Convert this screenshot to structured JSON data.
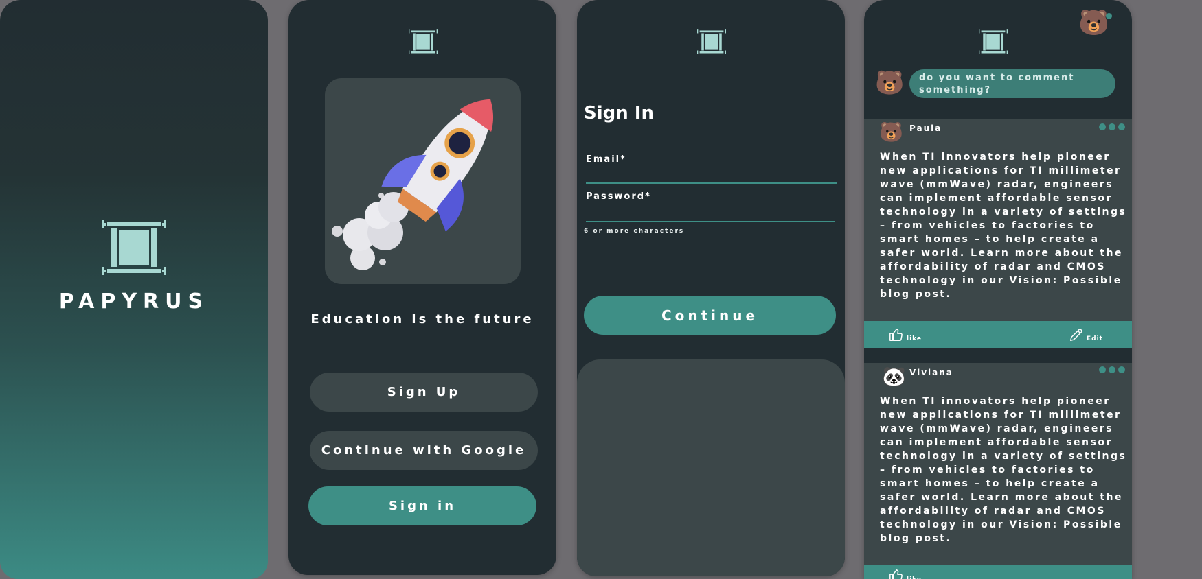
{
  "splash": {
    "brand": "PAPYRUS"
  },
  "welcome": {
    "tagline": "Education is the future",
    "signup_label": "Sign Up",
    "google_label": "Continue with Google",
    "signin_label": "Sign in"
  },
  "signin": {
    "title": "Sign In",
    "email_label": "Email*",
    "password_label": "Password*",
    "password_helper": "6 or more characters",
    "continue_label": "Continue"
  },
  "feed": {
    "comment_placeholder": "do you want to comment something?",
    "posts": [
      {
        "author": "Paula",
        "avatar": "🐻",
        "text": "When TI innovators help pioneer new applications for TI millimeter wave (mmWave) radar, engineers can implement affordable sensor technology in a variety of settings – from vehicles to factories to smart homes – to help create a safer world. Learn more about the affordability of radar and CMOS technology in our Vision: Possible blog post.",
        "like_label": "like",
        "edit_label": "Edit"
      },
      {
        "author": "Viviana",
        "avatar": "🐼",
        "text": "When TI innovators help pioneer new applications for TI millimeter wave (mmWave) radar, engineers can implement affordable sensor technology in a variety of settings – from vehicles to factories to smart homes – to help create a safer world. Learn more about the affordability of radar and CMOS technology in our Vision: Possible blog post.",
        "like_label": "like"
      }
    ],
    "user_avatar": "🐻"
  },
  "colors": {
    "background": "#222d32",
    "card": "#3c4749",
    "accent": "#3e8f86",
    "logo": "#a8d8d2",
    "page": "#6e6c70"
  },
  "icons": {
    "logo": "scroll-pillar-icon",
    "like": "thumbs-up-icon",
    "edit": "pencil-icon",
    "menu": "three-dots-icon",
    "hero": "rocket-illustration"
  }
}
